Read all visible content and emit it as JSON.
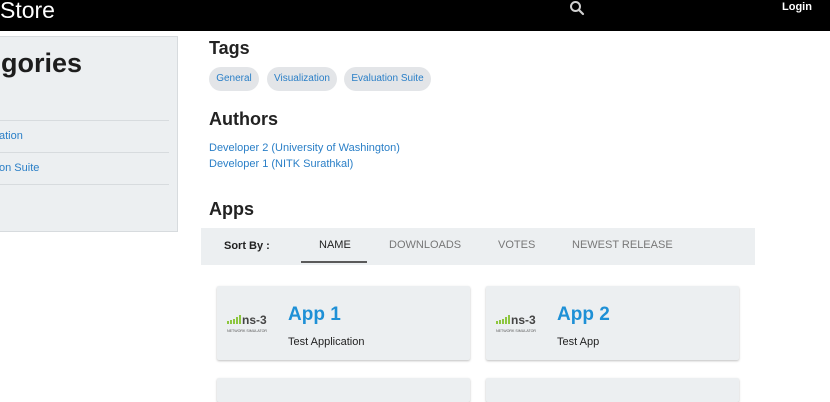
{
  "header": {
    "brand": "Store",
    "login_label": "Login"
  },
  "sidebar": {
    "title": "gories",
    "items": [
      {
        "label": ""
      },
      {
        "label": "ation"
      },
      {
        "label": "on Suite"
      }
    ]
  },
  "tags": {
    "heading": "Tags",
    "items": [
      "General",
      "Visualization",
      "Evaluation Suite"
    ]
  },
  "authors": {
    "heading": "Authors",
    "items": [
      "Developer 2 (University of Washington)",
      "Developer 1 (NITK Surathkal)"
    ]
  },
  "apps": {
    "heading": "Apps",
    "sort_label": "Sort By :",
    "sort_tabs": [
      "NAME",
      "DOWNLOADS",
      "VOTES",
      "NEWEST RELEASE"
    ],
    "active_sort": "NAME",
    "cards": [
      {
        "name": "App 1",
        "description": "Test Application",
        "logo_text": "ns-3",
        "logo_subtext": "NETWORK SIMULATOR"
      },
      {
        "name": "App 2",
        "description": "Test App",
        "logo_text": "ns-3",
        "logo_subtext": "NETWORK SIMULATOR"
      },
      {
        "name": "",
        "description": ""
      },
      {
        "name": "",
        "description": ""
      }
    ]
  },
  "colors": {
    "link": "#2a7fc7",
    "app_title": "#1e90d6",
    "topbar": "#000000",
    "panel": "#eceff1",
    "ns3_green": "#8dc63f"
  },
  "icons": {
    "search": "search-icon"
  }
}
